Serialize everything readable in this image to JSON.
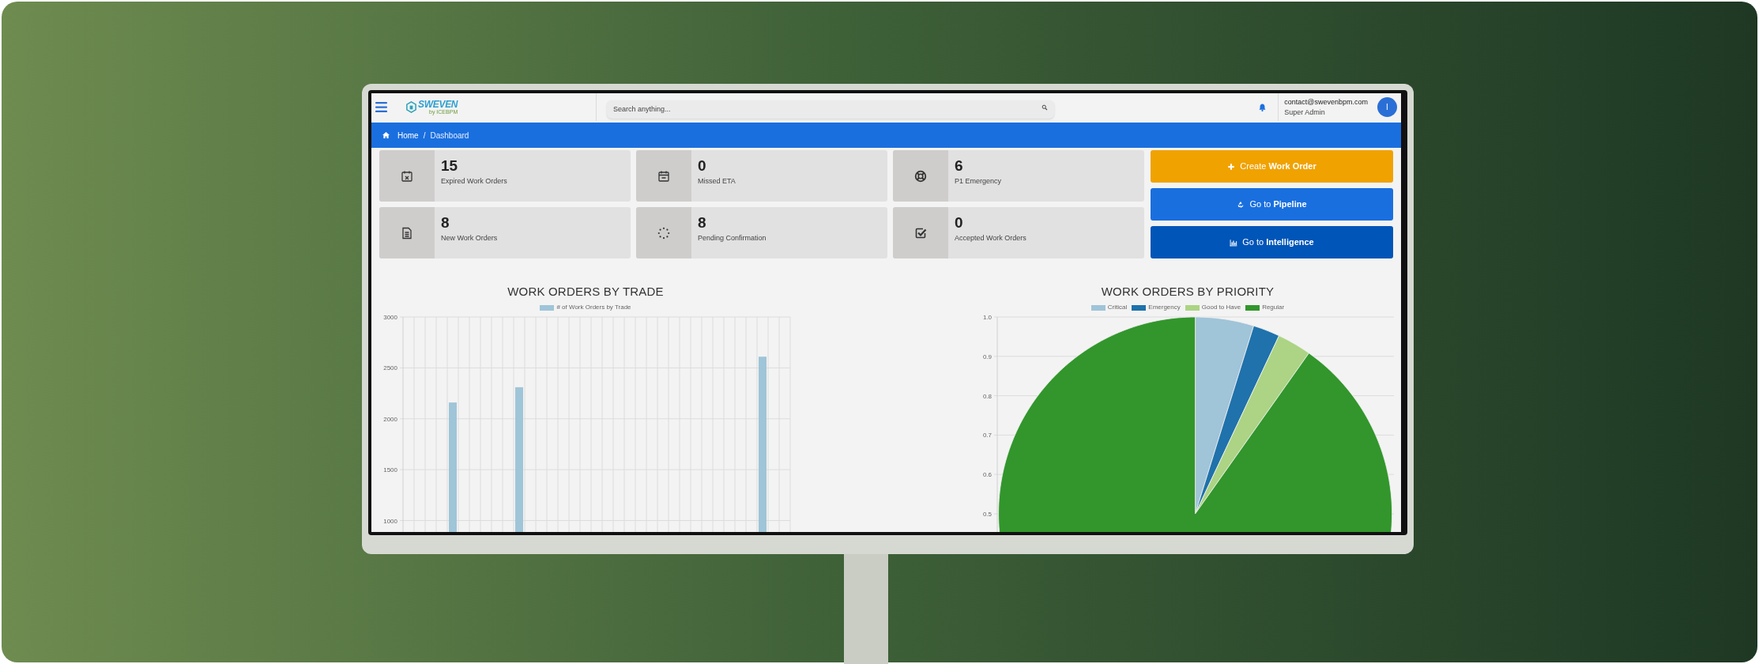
{
  "header": {
    "logo": {
      "name": "SWEVEN",
      "tagline": "by ICEBPM"
    },
    "search": {
      "placeholder": "Search anything..."
    },
    "user": {
      "email": "contact@swevenbpm.com",
      "role": "Super Admin",
      "avatar_initial": "I"
    }
  },
  "breadcrumb": {
    "items": [
      "Home",
      "Dashboard"
    ],
    "separator": "/"
  },
  "stats": [
    {
      "value": "15",
      "label": "Expired Work Orders"
    },
    {
      "value": "0",
      "label": "Missed ETA"
    },
    {
      "value": "6",
      "label": "P1 Emergency"
    },
    {
      "value": "8",
      "label": "New Work Orders"
    },
    {
      "value": "8",
      "label": "Pending Confirmation"
    },
    {
      "value": "0",
      "label": "Accepted Work Orders"
    }
  ],
  "actions": [
    {
      "label": "Create **Work Order**",
      "color": "#f0a200"
    },
    {
      "label": "Go to **Pipeline**",
      "color": "#1a6fdf"
    },
    {
      "label": "Go to **Intelligence**",
      "color": "#0055b8"
    }
  ],
  "charts": [
    {
      "title": "WORK ORDERS BY TRADE",
      "chart_data": {
        "type": "bar",
        "grid": true,
        "ylim": [
          880,
          3000
        ],
        "yticks": [
          1000,
          1500,
          2000,
          2500,
          3000
        ],
        "series": [
          {
            "name": "# of Work Orders by Trade",
            "color": "#9fc5d8",
            "values": [
              null,
              null,
              null,
              null,
              2160,
              null,
              null,
              null,
              null,
              null,
              2310,
              null,
              null,
              null,
              null,
              null,
              null,
              null,
              null,
              null,
              null,
              null,
              null,
              null,
              null,
              null,
              null,
              null,
              null,
              null,
              null,
              null,
              2610,
              null,
              null
            ]
          }
        ]
      }
    },
    {
      "title": "WORK ORDERS BY PRIORITY",
      "axis_labels": [
        "1.0",
        "0.9",
        "0.8",
        "0.7",
        "0.6",
        "0.5"
      ],
      "chart_data": {
        "type": "pie",
        "legend": true,
        "categories": [
          "Critical",
          "Emergency",
          "Good to Have",
          "Regular"
        ],
        "colors": [
          "#a0c4d8",
          "#1f72ab",
          "#acd484",
          "#32962c"
        ],
        "values": [
          4.8,
          2.2,
          2.8,
          90.2
        ]
      }
    }
  ]
}
